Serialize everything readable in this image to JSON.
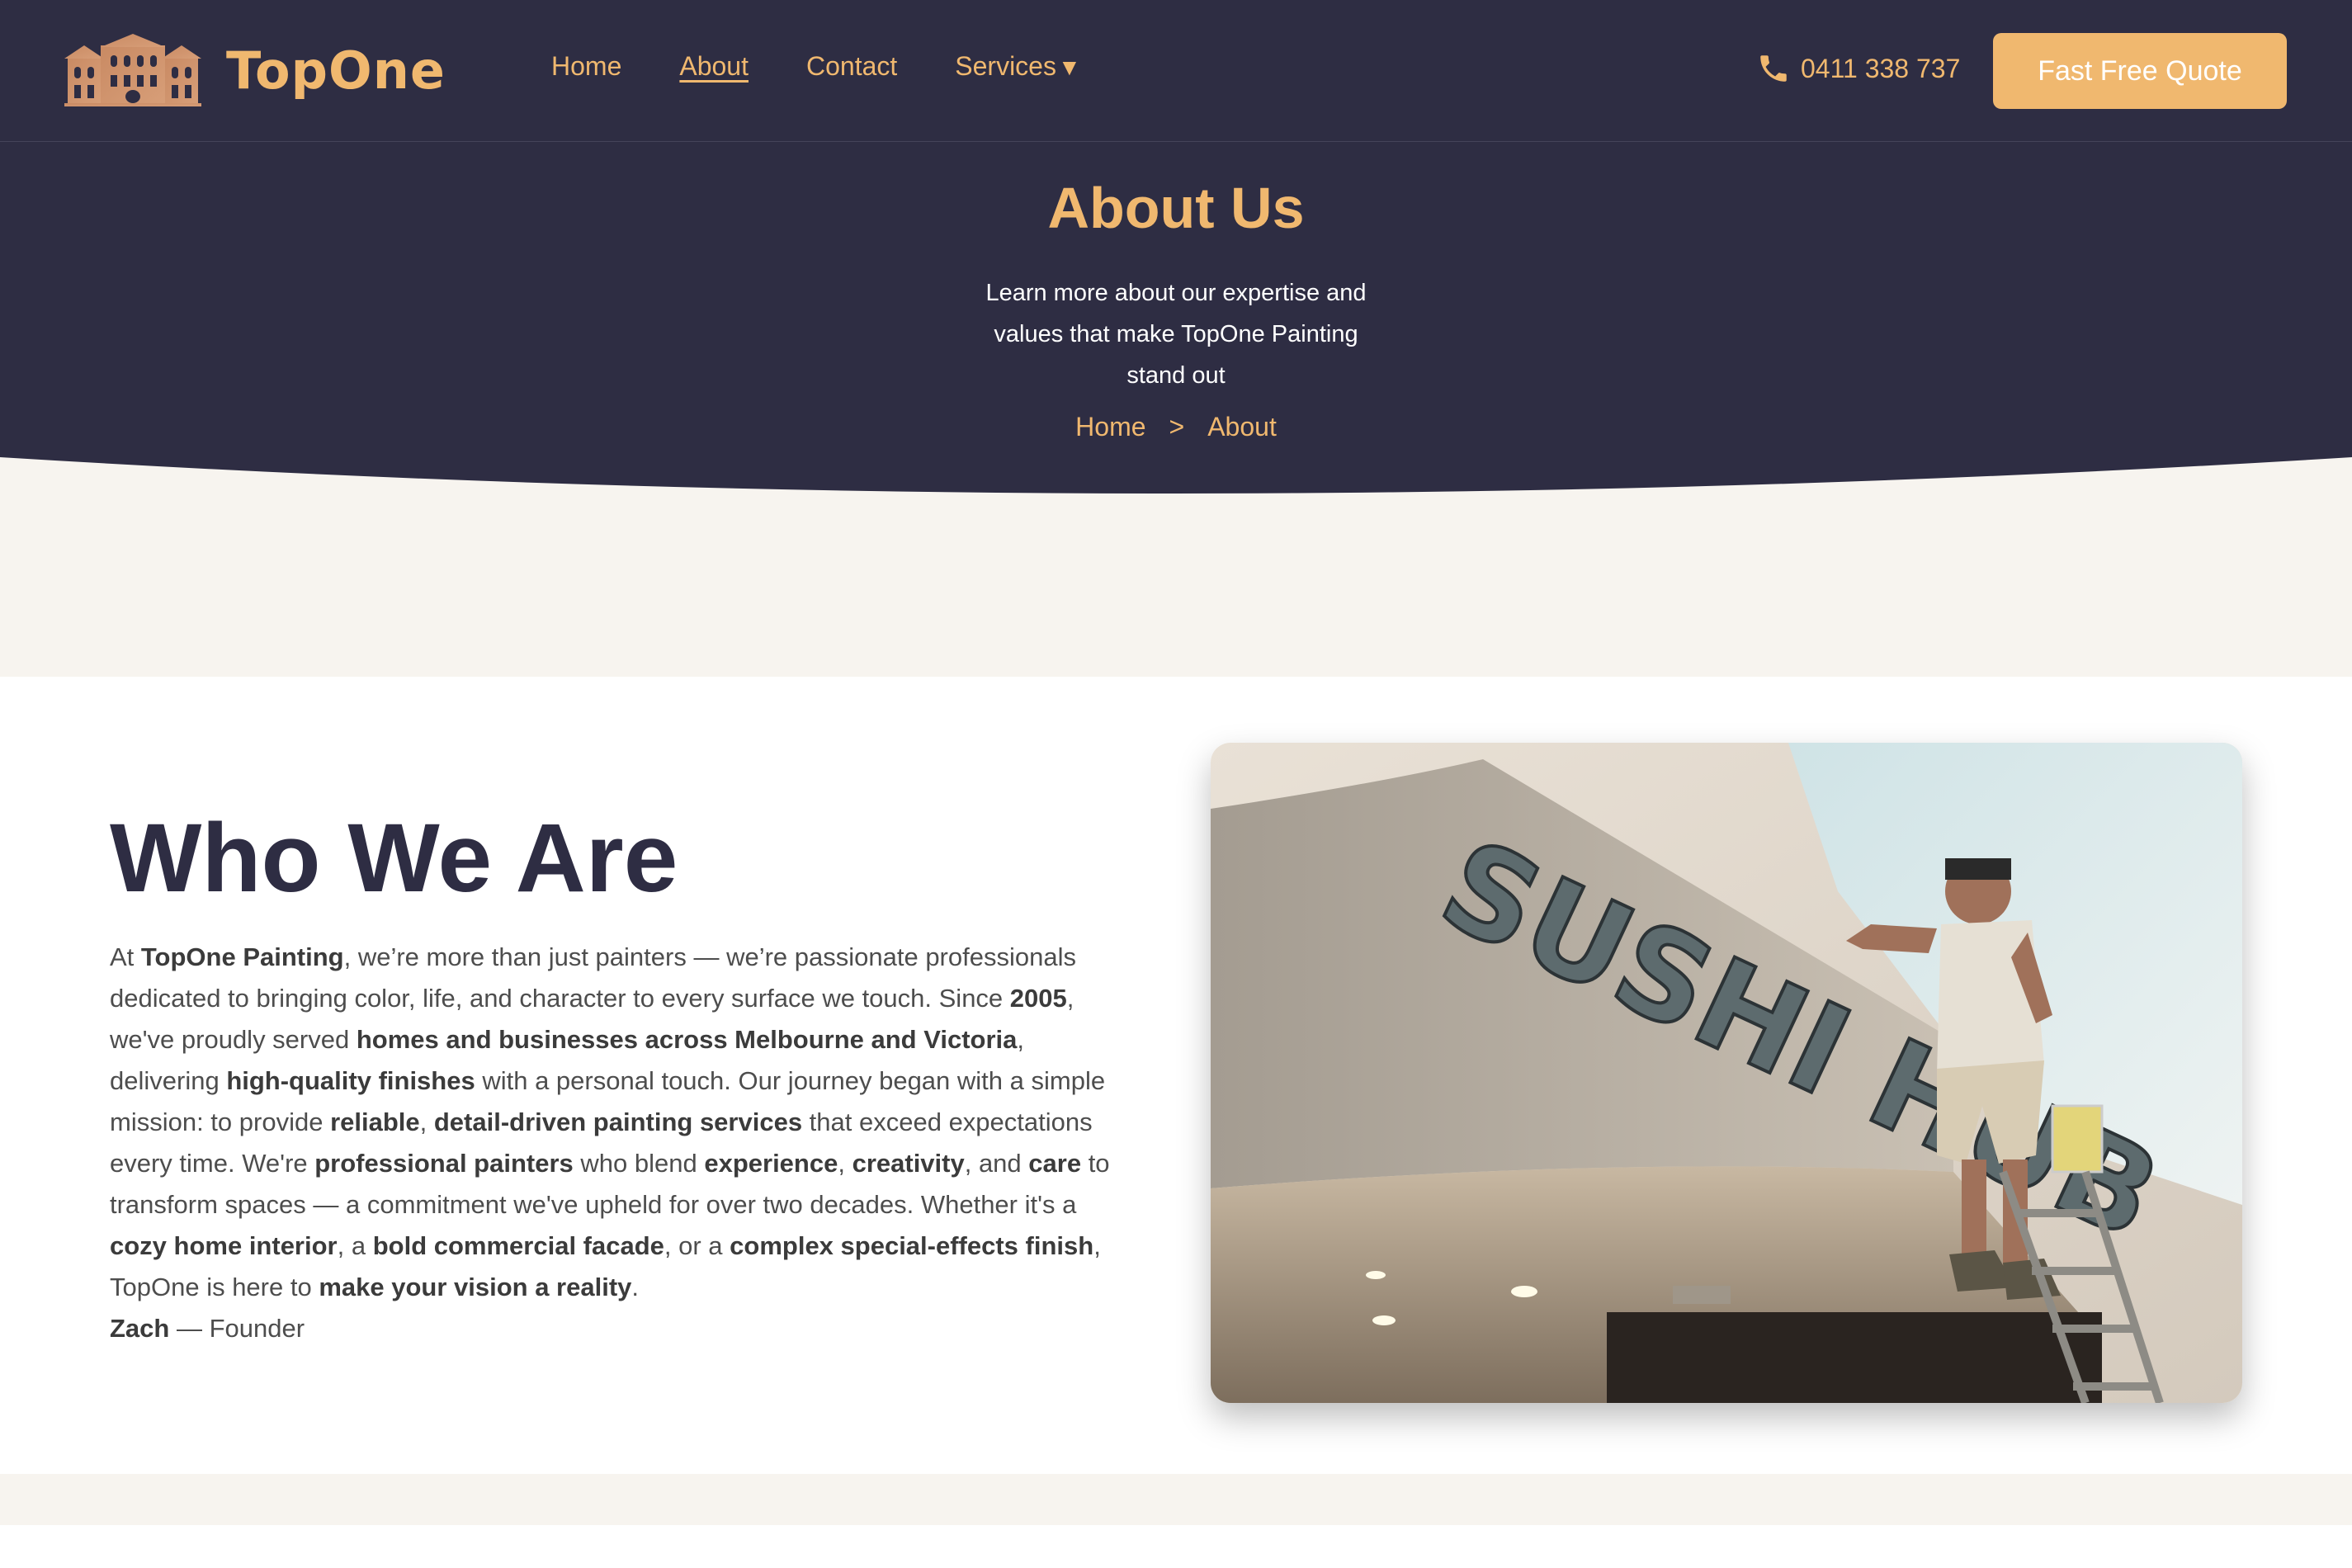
{
  "header": {
    "brand": "TopOne",
    "nav": {
      "home": "Home",
      "about": "About",
      "contact": "Contact",
      "services": "Services",
      "services_caret": "▼"
    },
    "phone": "0411 338 737",
    "quote_button": "Fast Free Quote"
  },
  "hero": {
    "title": "About Us",
    "subtitle_lines": [
      "Learn more about our expertise and",
      "values that make TopOne Painting",
      "stand out"
    ],
    "breadcrumb": {
      "home": "Home",
      "separator": ">",
      "current": "About"
    }
  },
  "who": {
    "title": "Who We Are",
    "paragraph": [
      {
        "t": "At "
      },
      {
        "b": "TopOne Painting"
      },
      {
        "t": ", we’re more than just painters — we’re passionate professionals dedicated to bringing color, life, and character to every surface we touch. Since "
      },
      {
        "b": "2005"
      },
      {
        "t": ", we've proudly served "
      },
      {
        "b": "homes and businesses across Melbourne and Victoria"
      },
      {
        "t": ", delivering "
      },
      {
        "b": "high-quality finishes"
      },
      {
        "t": " with a personal touch. Our journey began with a simple mission: to provide "
      },
      {
        "b": "reliable"
      },
      {
        "t": ", "
      },
      {
        "b": "detail-driven painting services"
      },
      {
        "t": " that exceed expectations every time. We're "
      },
      {
        "b": "professional painters"
      },
      {
        "t": " who blend "
      },
      {
        "b": "experience"
      },
      {
        "t": ", "
      },
      {
        "b": "creativity"
      },
      {
        "t": ", and "
      },
      {
        "b": "care"
      },
      {
        "t": " to transform spaces — a commitment we've upheld for over two decades. Whether it's a "
      },
      {
        "b": "cozy home interior"
      },
      {
        "t": ", a "
      },
      {
        "b": "bold commercial facade"
      },
      {
        "t": ", or a "
      },
      {
        "b": "complex special-effects finish"
      },
      {
        "t": ", TopOne is here to "
      },
      {
        "b": "make your vision a reality"
      },
      {
        "t": "."
      }
    ],
    "signature_name": "Zach",
    "signature_role": " — Founder",
    "photo_sign_text": "SUSHI HUB"
  },
  "colors": {
    "navy": "#2e2d43",
    "accent": "#f0b86f",
    "cream": "#f7f4ef"
  },
  "icons": {
    "logo": "building-icon",
    "phone": "phone-icon"
  }
}
